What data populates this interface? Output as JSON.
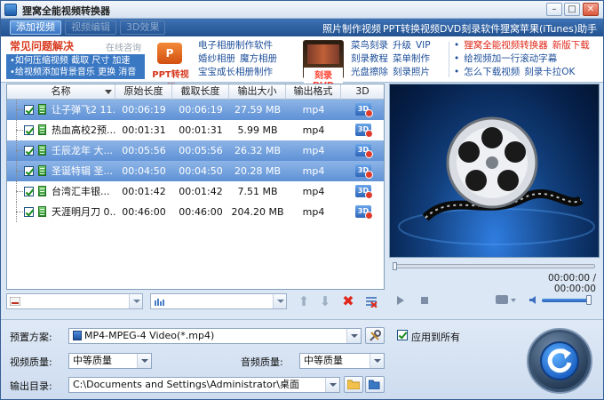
{
  "window": {
    "title": "狸窝全能视频转换器"
  },
  "toolbar": {
    "buttons": [
      "添加视频",
      "视频编辑",
      "3D效果"
    ],
    "links": [
      "照片制作视频",
      "PPT转换视频",
      "DVD刻录软件",
      "狸窝苹果(iTunes)助手"
    ]
  },
  "faq": {
    "title": "常见问题解决",
    "online": "在线咨询",
    "line1": "•如何压缩视频  截取  尺寸  加速",
    "line2": "•给视频添加背景音乐  更换  消音"
  },
  "promo": {
    "ppt_logo": "P",
    "ppt_caption": "PPT转视频",
    "dvd_caption": "刻录DVD",
    "col1": [
      [
        "电子相册制作软件"
      ],
      [
        "婚纱相册",
        "魔方相册"
      ],
      [
        "宝宝成长相册制作"
      ]
    ],
    "col2": [
      [
        "菜鸟刻录",
        "升级",
        "VIP"
      ],
      [
        "刻录教程",
        "菜单制作"
      ],
      [
        "光盘擦除",
        "刻录照片"
      ]
    ],
    "col3": [
      [
        "•",
        "狸窝全能视频转换器",
        "新版下载"
      ],
      [
        "•",
        "给视频加一行滚动字幕"
      ],
      [
        "•",
        "怎么下载视频",
        "刻录卡拉OK"
      ]
    ]
  },
  "list": {
    "columns": [
      "名称",
      "原始长度",
      "截取长度",
      "输出大小",
      "输出格式",
      "3D"
    ],
    "badge": "3D",
    "rows": [
      {
        "name": "让子弹飞2 11...",
        "orig": "00:06:19",
        "cut": "00:06:19",
        "size": "27.59 MB",
        "fmt": "mp4",
        "selected": true
      },
      {
        "name": "热血高校2预...",
        "orig": "00:01:31",
        "cut": "00:01:31",
        "size": "5.99 MB",
        "fmt": "mp4",
        "selected": false
      },
      {
        "name": "壬辰龙年 大...",
        "orig": "00:05:56",
        "cut": "00:05:56",
        "size": "26.32 MB",
        "fmt": "mp4",
        "selected": true
      },
      {
        "name": "圣诞特辑 圣...",
        "orig": "00:04:50",
        "cut": "00:04:50",
        "size": "20.28 MB",
        "fmt": "mp4",
        "selected": true
      },
      {
        "name": "台湾汇丰银...",
        "orig": "00:01:42",
        "cut": "00:01:42",
        "size": "7.51 MB",
        "fmt": "mp4",
        "selected": false
      },
      {
        "name": "天涯明月刀 0...",
        "orig": "00:46:00",
        "cut": "00:46:00",
        "size": "204.20 MB",
        "fmt": "mp4",
        "selected": false
      }
    ]
  },
  "player": {
    "time": "00:00:00 / 00:00:00",
    "volume": 0.95,
    "progress": 0.0
  },
  "settings": {
    "preset_label": "预置方案:",
    "preset_value": "MP4-MPEG-4 Video(*.mp4)",
    "apply_all": "应用到所有",
    "video_quality_label": "视频质量:",
    "video_quality_value": "中等质量",
    "audio_quality_label": "音频质量:",
    "audio_quality_value": "中等质量",
    "output_label": "输出目录:",
    "output_value": "C:\\Documents and Settings\\Administrator\\桌面"
  },
  "colors": {
    "accent": "#2e66b8",
    "selection": "#6e9cdc",
    "link": "#1f4f9a",
    "highlight": "#e0281a"
  }
}
